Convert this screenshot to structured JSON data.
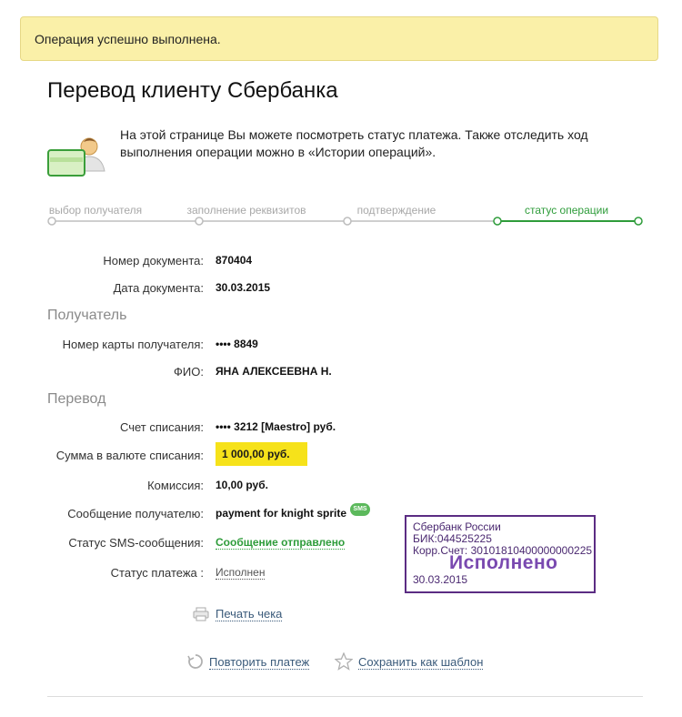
{
  "alert": {
    "text": "Операция успешно выполнена."
  },
  "page": {
    "title": "Перевод клиенту Сбербанка",
    "intro": "На этой странице Вы можете посмотреть статус платежа. Также отследить ход выполнения операции можно в «Истории операций»."
  },
  "steps": [
    {
      "label": "выбор получателя",
      "state": "done"
    },
    {
      "label": "заполнение реквизитов",
      "state": "done"
    },
    {
      "label": "подтверждение",
      "state": "done"
    },
    {
      "label": "статус операции",
      "state": "active"
    }
  ],
  "document": {
    "number_label": "Номер документа:",
    "number": "870404",
    "date_label": "Дата документа:",
    "date": "30.03.2015"
  },
  "recipient": {
    "section": "Получатель",
    "card_label": "Номер карты получателя:",
    "card": "•••• 8849",
    "fio_label": "ФИО:",
    "fio": "ЯНА АЛЕКСЕЕВНА Н."
  },
  "transfer": {
    "section": "Перевод",
    "account_label": "Счет списания:",
    "account": "•••• 3212  [Maestro]  руб.",
    "amount_label": "Сумма в валюте списания:",
    "amount": "1 000,00  руб.",
    "fee_label": "Комиссия:",
    "fee": "10,00 руб.",
    "message_label": "Сообщение получателю:",
    "message": "payment for knight sprite",
    "sms_badge": "SMS",
    "sms_status_label": "Статус SMS-сообщения:",
    "sms_status": "Сообщение отправлено",
    "payment_status_label": "Статус платежа :",
    "payment_status": "Исполнен"
  },
  "stamp": {
    "line1": "Сбербанк России",
    "line2": "БИК:044525225",
    "line3": "Корр.Счет: 30101810400000000225",
    "big": "Исполнено",
    "date": "30.03.2015"
  },
  "actions": {
    "print": "Печать чека",
    "repeat": "Повторить платеж",
    "save_template": "Сохранить как шаблон"
  },
  "colors": {
    "accent_green": "#2e9c3a",
    "alert_bg": "#faf0a8",
    "highlight": "#f6e21a",
    "stamp": "#5b2c83",
    "link": "#3a5a7a"
  }
}
